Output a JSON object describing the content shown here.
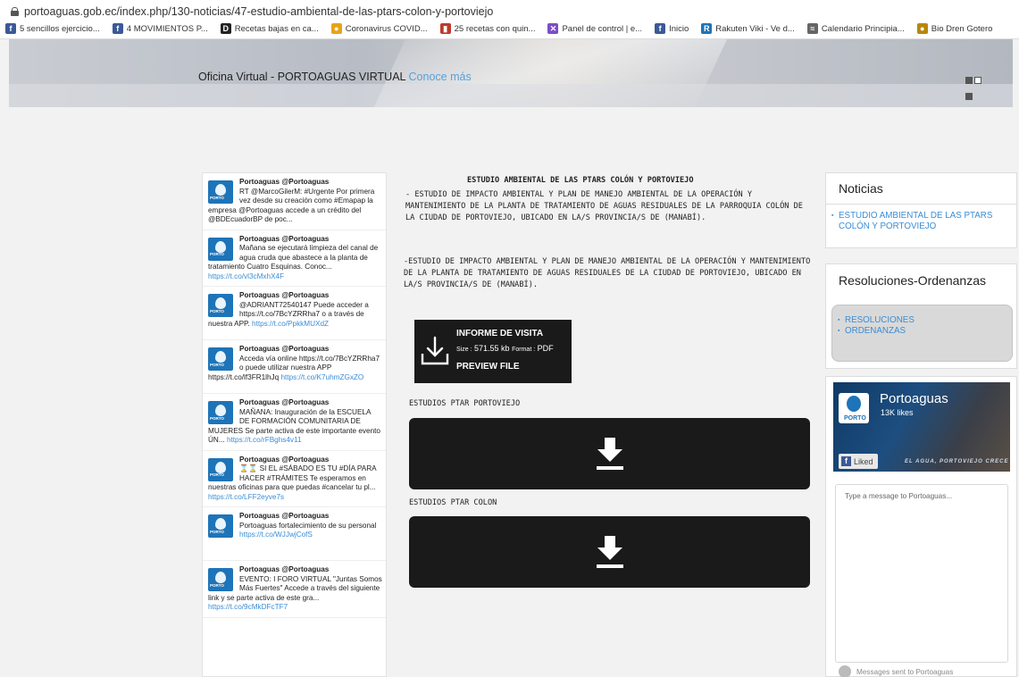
{
  "browser": {
    "url": "portoaguas.gob.ec/index.php/130-noticias/47-estudio-ambiental-de-las-ptars-colon-y-portoviejo",
    "bookmarks": [
      {
        "icon": "facebook-icon",
        "label": "5 sencillos ejercicio...",
        "color": "#3b5998",
        "glyph": "f"
      },
      {
        "icon": "facebook-icon",
        "label": "4 MOVIMIENTOS P...",
        "color": "#3b5998",
        "glyph": "f"
      },
      {
        "icon": "recipe-icon",
        "label": "Recetas bajas en ca...",
        "color": "#222222",
        "glyph": "D"
      },
      {
        "icon": "covid-icon",
        "label": "Coronavirus COVID...",
        "color": "#e8a317",
        "glyph": "●"
      },
      {
        "icon": "bars-icon",
        "label": "25 recetas con quin...",
        "color": "#c0392b",
        "glyph": "▮"
      },
      {
        "icon": "panel-icon",
        "label": "Panel de control | e...",
        "color": "#7a4ec9",
        "glyph": "✕"
      },
      {
        "icon": "facebook-icon",
        "label": "Inicio",
        "color": "#3b5998",
        "glyph": "f"
      },
      {
        "icon": "rakuten-icon",
        "label": "Rakuten Viki - Ve d...",
        "color": "#1e74b8",
        "glyph": "R"
      },
      {
        "icon": "calendar-icon",
        "label": "Calendario Principia...",
        "color": "#666666",
        "glyph": "≈"
      },
      {
        "icon": "biodren-icon",
        "label": "Bio Dren Gotero",
        "color": "#b8860b",
        "glyph": "●"
      }
    ]
  },
  "header": {
    "office_text": "Oficina Virtual - PORTOAGUAS VIRTUAL",
    "link_text": "Conoce más"
  },
  "tweets": [
    {
      "name": "Portoaguas",
      "handle": "@Portoaguas",
      "text": "RT @MarcoGilerM: #Urgente Por primera vez desde su creación como #Emapap la empresa @Portoaguas accede a un crédito del @BDEcuadorBP de poc...",
      "link": ""
    },
    {
      "name": "Portoaguas",
      "handle": "@Portoaguas",
      "text": "Mañana se ejecutará limpieza del canal de agua cruda que abastece a la planta de tratamiento Cuatro Esquinas. Conoc...",
      "link": "https://t.co/vl3cMxhX4F"
    },
    {
      "name": "Portoaguas",
      "handle": "@Portoaguas",
      "text": "@ADRIANT72540147 Puede acceder a https://t.co/7BcYZRRha7 o a través de nuestra APP.",
      "link": "https://t.co/PpkkMUXdZ"
    },
    {
      "name": "Portoaguas",
      "handle": "@Portoaguas",
      "text": "Acceda vía online https://t.co/7BcYZRRha7 o puede utilizar nuestra APP https://t.co/lf3FR1lhJq",
      "link": "https://t.co/K7uhmZGxZO"
    },
    {
      "name": "Portoaguas",
      "handle": "@Portoaguas",
      "text": "MAÑANA: Inauguración de la ESCUELA DE FORMACIÓN COMUNITARIA DE MUJERES Se parte activa de este importante evento ÚN...",
      "link": "https://t.co/rFBghs4v11"
    },
    {
      "name": "Portoaguas",
      "handle": "@Portoaguas",
      "text": "⌛⌛ SI EL #SÁBADO ES TU #DÍA PARA HACER #TRÁMITES Te esperamos en nuestras oficinas para que puedas #cancelar tu pl...",
      "link": "https://t.co/LFF2eyve7s"
    },
    {
      "name": "Portoaguas",
      "handle": "@Portoaguas",
      "text": "Portoaguas fortalecimiento de su personal",
      "link": "https://t.co/WJJwjCofS"
    },
    {
      "name": "Portoaguas",
      "handle": "@Portoaguas",
      "text": "EVENTO: I FORO VIRTUAL \"Juntas Somos Más Fuertes\" Accede a través del siguiente link y se parte activa de este gra...",
      "link": "https://t.co/9cMkDFcTF7"
    }
  ],
  "article": {
    "title": "ESTUDIO AMBIENTAL DE LAS PTARS COLÓN Y PORTOVIEJO",
    "para1": "- ESTUDIO DE IMPACTO AMBIENTAL Y PLAN DE MANEJO AMBIENTAL DE LA OPERACIÓN Y MANTENIMIENTO DE LA PLANTA DE TRATAMIENTO DE AGUAS RESIDUALES DE LA PARROQUIA COLÓN DE LA CIUDAD DE PORTOVIEJO, UBICADO EN LA/S PROVINCIA/S DE (MANABÍ).",
    "para2": "-ESTUDIO DE IMPACTO AMBIENTAL Y PLAN DE MANEJO AMBIENTAL DE LA OPERACIÓN Y MANTENIMIENTO DE LA PLANTA DE TRATAMIENTO DE AGUAS RESIDUALES DE LA CIUDAD DE PORTOVIEJO, UBICADO EN LA/S PROVINCIA/S DE (MANABÍ).",
    "pdf": {
      "title": "INFORME DE VISITA",
      "size_label": "Size :",
      "size_value": "571.55 kb",
      "format_label": "Format :",
      "format_value": "PDF",
      "preview": "PREVIEW FILE"
    },
    "section1": "ESTUDIOS PTAR PORTOVIEJO",
    "section2": "ESTUDIOS PTAR COLON"
  },
  "sidebar": {
    "news_title": "Noticias",
    "news_items": [
      "ESTUDIO AMBIENTAL DE LAS PTARS COLÓN Y PORTOVIEJO"
    ],
    "res_title": "Resoluciones-Ordenanzas",
    "res_items": [
      "RESOLUCIONES",
      "ORDENANZAS"
    ]
  },
  "facebook": {
    "page_name": "Portoaguas",
    "likes": "13K likes",
    "liked_label": "Liked",
    "slogan": "EL AGUA, PORTOVIEJO CRECE",
    "message_placeholder": "Type a message to Portoaguas...",
    "footer": "Messages sent to Portoaguas"
  },
  "colors": {
    "link": "#3b8dd4",
    "dark_button": "#1a1a1a"
  }
}
